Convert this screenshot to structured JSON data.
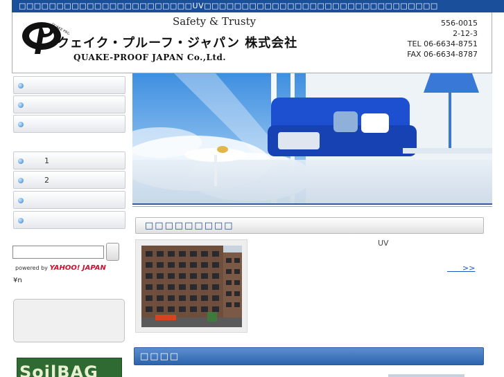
{
  "top_bar": {
    "text": "□□□□□□□□□□□□□□□□□□□□□□□UV□□□□□□□□□□□□□□□□□□□□□□□□□□□□□□□"
  },
  "header": {
    "tagline": "Safety & Trusty",
    "company_jp": "クェイク・プルーフ・ジャパン 株式会社",
    "company_en": "QUAKE-PROOF JAPAN Co.,Ltd.",
    "logo_text": "QUAKE PROOF JAPAN",
    "contact": {
      "postal": "556-0015",
      "address": "2-12-3",
      "tel": "TEL 06-6634-8751",
      "fax": "FAX 06-6634-8787"
    }
  },
  "sidebar": {
    "menu_group_1": [
      {
        "label": ""
      },
      {
        "label": ""
      },
      {
        "label": ""
      }
    ],
    "menu_group_2": [
      {
        "label": "1"
      },
      {
        "label": "2"
      },
      {
        "label": ""
      },
      {
        "label": ""
      }
    ],
    "search": {
      "placeholder": "",
      "button_label": ""
    },
    "powered_by": "powered by",
    "powered_brand": "YAHOO! JAPAN",
    "yen_text": "¥n",
    "banner_text": "SoilBAG"
  },
  "main": {
    "section_title": "□□□□□□□□□",
    "uv_text": "UV",
    "more_link": "　　>>",
    "section2_title": "□□□□"
  },
  "colors": {
    "accent": "#1a4f9c",
    "link": "#1a56c4",
    "banner_green": "#2f6a33"
  }
}
